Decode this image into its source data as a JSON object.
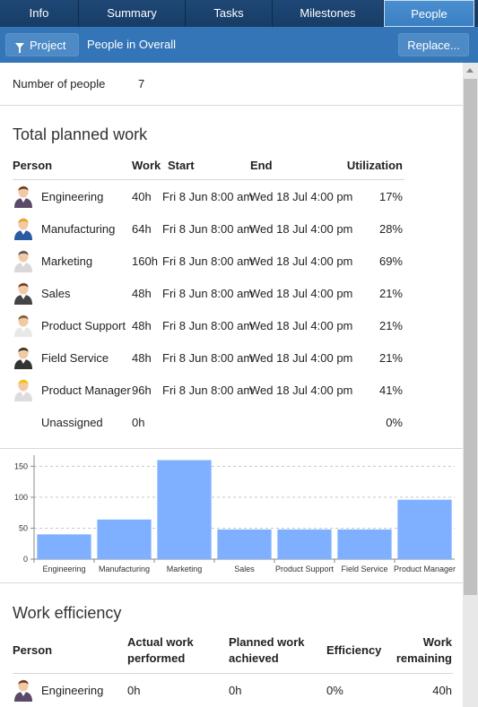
{
  "tabs": [
    {
      "label": "Info",
      "active": false
    },
    {
      "label": "Summary",
      "active": false
    },
    {
      "label": "Tasks",
      "active": false
    },
    {
      "label": "Milestones",
      "active": false
    },
    {
      "label": "People",
      "active": true
    }
  ],
  "toolbar": {
    "project_label": "Project",
    "title": "People in Overall",
    "replace_label": "Replace..."
  },
  "summary": {
    "people_label": "Number of people",
    "people_count": "7"
  },
  "planned": {
    "title": "Total planned work",
    "headers": {
      "person": "Person",
      "work": "Work",
      "start": "Start",
      "end": "End",
      "utilization": "Utilization"
    },
    "rows": [
      {
        "person": "Engineering",
        "work": "40h",
        "start": "Fri 8 Jun 8:00 am",
        "end": "Wed 18 Jul 4:00 pm",
        "utilization": "17%",
        "icon": "businesswoman-icon"
      },
      {
        "person": "Manufacturing",
        "work": "64h",
        "start": "Fri 8 Jun 8:00 am",
        "end": "Wed 18 Jul 4:00 pm",
        "utilization": "28%",
        "icon": "worker-helmet-icon"
      },
      {
        "person": "Marketing",
        "work": "160h",
        "start": "Fri 8 Jun 8:00 am",
        "end": "Wed 18 Jul 4:00 pm",
        "utilization": "69%",
        "icon": "phone-person-icon"
      },
      {
        "person": "Sales",
        "work": "48h",
        "start": "Fri 8 Jun 8:00 am",
        "end": "Wed 18 Jul 4:00 pm",
        "utilization": "21%",
        "icon": "woman-icon"
      },
      {
        "person": "Product Support",
        "work": "48h",
        "start": "Fri 8 Jun 8:00 am",
        "end": "Wed 18 Jul 4:00 pm",
        "utilization": "21%",
        "icon": "man-icon"
      },
      {
        "person": "Field Service",
        "work": "48h",
        "start": "Fri 8 Jun 8:00 am",
        "end": "Wed 18 Jul 4:00 pm",
        "utilization": "21%",
        "icon": "businessman-icon"
      },
      {
        "person": "Product Manager",
        "work": "96h",
        "start": "Fri 8 Jun 8:00 am",
        "end": "Wed 18 Jul 4:00 pm",
        "utilization": "41%",
        "icon": "engineer-wrench-icon"
      },
      {
        "person": "Unassigned",
        "work": "0h",
        "start": "",
        "end": "",
        "utilization": "0%",
        "icon": ""
      }
    ]
  },
  "chart_data": {
    "type": "bar",
    "categories": [
      "Engineering",
      "Manufacturing",
      "Marketing",
      "Sales",
      "Product Support",
      "Field Service",
      "Product Manager"
    ],
    "values": [
      40,
      64,
      160,
      48,
      48,
      48,
      96
    ],
    "yticks": [
      "0",
      "50",
      "100",
      "150"
    ],
    "ylim": [
      0,
      165
    ],
    "grid": true,
    "bar_color": "#7fb0ff"
  },
  "efficiency": {
    "title": "Work efficiency",
    "headers": {
      "person": "Person",
      "actual_1": "Actual work",
      "actual_2": "performed",
      "planned_1": "Planned work",
      "planned_2": "achieved",
      "efficiency": "Efficiency",
      "remaining_1": "Work",
      "remaining_2": "remaining"
    },
    "rows": [
      {
        "person": "Engineering",
        "actual": "0h",
        "planned": "0h",
        "efficiency": "0%",
        "remaining": "40h",
        "icon": "businesswoman-icon"
      }
    ]
  },
  "colors": {
    "tab_bg": "#1a3d63",
    "tab_active": "#3a7fc2",
    "toolbar": "#3375b6",
    "bar": "#7fb0ff"
  }
}
